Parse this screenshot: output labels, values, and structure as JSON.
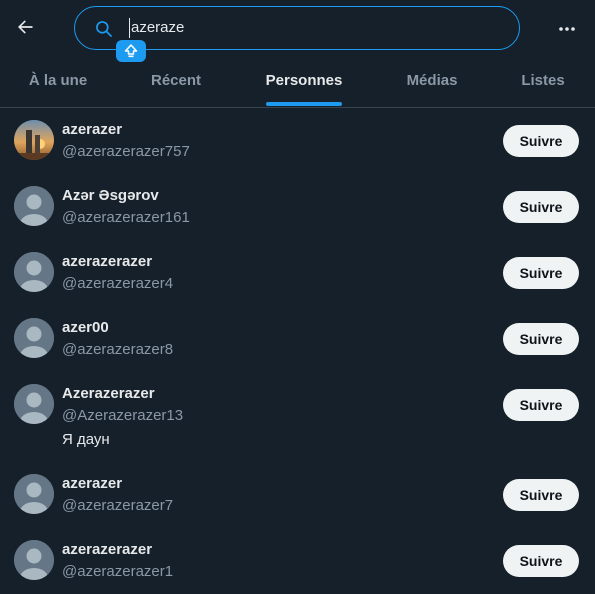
{
  "search": {
    "value": "azeraze"
  },
  "tabs": [
    {
      "label": "À la une"
    },
    {
      "label": "Récent"
    },
    {
      "label": "Personnes",
      "active": true
    },
    {
      "label": "Médias"
    },
    {
      "label": "Listes"
    }
  ],
  "results": [
    {
      "name": "azerazer",
      "handle": "@azerazerazer757",
      "avatar": "photo-avatar",
      "follow_label": "Suivre"
    },
    {
      "name": "Azər Əsgərov",
      "handle": "@azerazerazer161",
      "avatar": "default-avatar",
      "follow_label": "Suivre"
    },
    {
      "name": "azerazerazer",
      "handle": "@azerazerazer4",
      "avatar": "default-avatar",
      "follow_label": "Suivre"
    },
    {
      "name": "azer00",
      "handle": "@azerazerazer8",
      "avatar": "default-avatar",
      "follow_label": "Suivre"
    },
    {
      "name": "Azerazerazer",
      "handle": "@Azerazerazer13",
      "bio": "Я даун",
      "avatar": "default-avatar",
      "follow_label": "Suivre"
    },
    {
      "name": "azerazer",
      "handle": "@azerazerazer7",
      "avatar": "default-avatar",
      "follow_label": "Suivre"
    },
    {
      "name": "azerazerazer",
      "handle": "@azerazerazer1",
      "avatar": "default-avatar",
      "follow_label": "Suivre"
    }
  ],
  "colors": {
    "background": "#15202b",
    "accent": "#1d9bf0",
    "text": "#e7e9ea",
    "muted": "#8b98a5",
    "button_bg": "#eff3f4"
  }
}
